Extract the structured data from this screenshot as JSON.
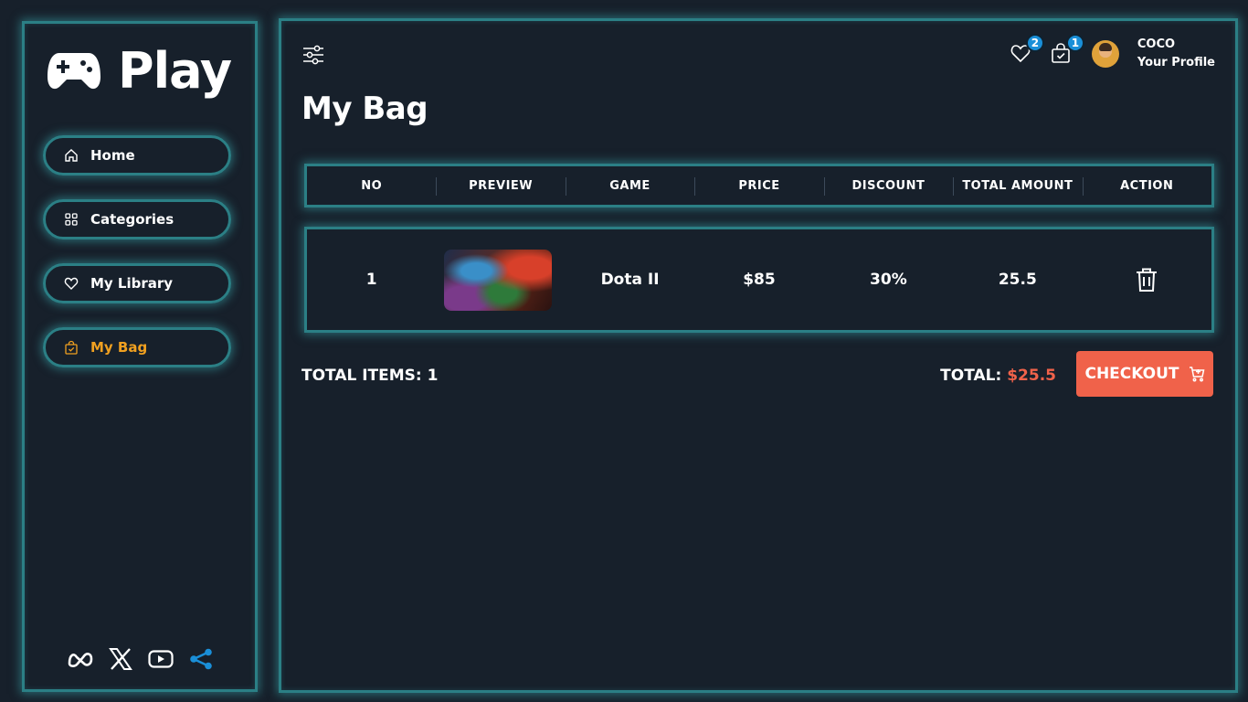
{
  "app": {
    "name": "Play"
  },
  "nav": {
    "items": [
      {
        "label": "Home",
        "icon": "home-icon"
      },
      {
        "label": "Categories",
        "icon": "grid-icon"
      },
      {
        "label": "My Library",
        "icon": "heart-icon"
      },
      {
        "label": "My Bag",
        "icon": "bag-icon",
        "active": true
      }
    ]
  },
  "social": [
    "meta-icon",
    "x-icon",
    "youtube-icon",
    "share-icon"
  ],
  "header": {
    "wishlist_count": "2",
    "bag_count": "1",
    "user_name": "COCO",
    "profile_label": "Your Profile"
  },
  "page": {
    "title": "My Bag"
  },
  "table": {
    "headers": [
      "NO",
      "PREVIEW",
      "GAME",
      "PRICE",
      "DISCOUNT",
      "TOTAL AMOUNT",
      "ACTION"
    ],
    "rows": [
      {
        "no": "1",
        "game": "Dota II",
        "price": "$85",
        "discount": "30%",
        "total_amount": "25.5"
      }
    ]
  },
  "summary": {
    "total_items_label": "TOTAL ITEMS: 1",
    "total_label": "TOTAL:",
    "total_value": "$25.5",
    "checkout_label": "CHECKOUT"
  },
  "colors": {
    "background": "#17202b",
    "accent_border": "#2b7f85",
    "active_nav": "#f0a020",
    "checkout": "#f0624a",
    "badge": "#1a8fd8"
  }
}
